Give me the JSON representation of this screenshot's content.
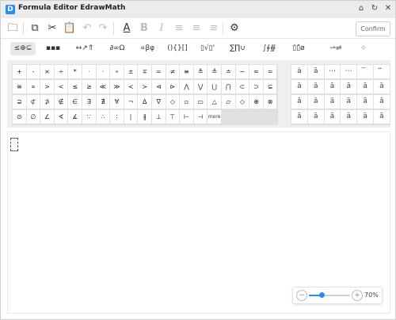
{
  "window": {
    "title": "Formula Editor EdrawMath",
    "logo_glyph": "D",
    "buttons": [
      {
        "name": "home-icon",
        "glyph": "⌂"
      },
      {
        "name": "refresh-icon",
        "glyph": "↻"
      },
      {
        "name": "close-icon",
        "glyph": "✕"
      }
    ]
  },
  "toolbar": {
    "tools": [
      {
        "name": "open-folder-button",
        "glyph": "🗀",
        "enabled": true
      },
      {
        "name": "copy-button",
        "glyph": "⧉",
        "enabled": true
      },
      {
        "name": "cut-button",
        "glyph": "✂",
        "enabled": true
      },
      {
        "name": "paste-button",
        "glyph": "📋",
        "enabled": true
      },
      {
        "name": "undo-button",
        "glyph": "↶",
        "enabled": false
      },
      {
        "name": "redo-button",
        "glyph": "↷",
        "enabled": false
      },
      {
        "name": "font-color-button",
        "glyph": "A",
        "enabled": true
      },
      {
        "name": "bold-button",
        "glyph": "B",
        "enabled": false
      },
      {
        "name": "italic-button",
        "glyph": "I",
        "enabled": false
      },
      {
        "name": "align-left-button",
        "glyph": "≡",
        "enabled": false
      },
      {
        "name": "align-center-button",
        "glyph": "≡",
        "enabled": false
      },
      {
        "name": "align-right-button",
        "glyph": "≡",
        "enabled": false
      },
      {
        "name": "settings-button",
        "glyph": "⚙",
        "enabled": true
      }
    ],
    "confirm_label": "Confirm"
  },
  "tabs": [
    {
      "name": "tab-relations",
      "label": "≤⊕⊆",
      "active": true
    },
    {
      "name": "tab-spaces",
      "label": "▪▪▪",
      "active": false
    },
    {
      "name": "tab-arrows",
      "label": "↔↗⇑",
      "active": false
    },
    {
      "name": "tab-misc",
      "label": "∂∞Ω",
      "active": false
    },
    {
      "name": "tab-greek",
      "label": "∝βφ",
      "active": false
    },
    {
      "name": "tab-brackets",
      "label": "(){}[]",
      "active": false
    },
    {
      "name": "tab-fractions",
      "label": "▯√▯'",
      "active": false
    },
    {
      "name": "tab-sums",
      "label": "∑∏∪",
      "active": false
    },
    {
      "name": "tab-integrals",
      "label": "∫∮∯",
      "active": false
    },
    {
      "name": "tab-accents",
      "label": "▯̇▯̂ø",
      "active": false
    },
    {
      "name": "tab-labeled-arrows",
      "label": "⇀⇌",
      "active": false
    },
    {
      "name": "tab-matrices",
      "label": "⁘",
      "active": false
    }
  ],
  "symbols": [
    [
      "+",
      "-",
      "×",
      "÷",
      "*",
      "·",
      "·",
      "∘",
      "±",
      "∓",
      "=",
      "≠",
      "≡",
      "≜",
      "≙",
      "≐",
      "∽",
      "≈",
      "≃"
    ],
    [
      "≅",
      "∝",
      ">",
      "<",
      "≤",
      "≥",
      "≪",
      "≫",
      "≺",
      "≻",
      "⊲",
      "⊳",
      "⋀",
      "⋁",
      "⋃",
      "⋂",
      "⊂",
      "⊃",
      "⊆"
    ],
    [
      "⊇",
      "⊄",
      "⊅",
      "∉",
      "∈",
      "∃",
      "∄",
      "∀",
      "¬",
      "∆",
      "∇",
      "◇",
      "▫",
      "▭",
      "△",
      "▱",
      "◇",
      "⊕",
      "⊗"
    ],
    [
      "⊙",
      "∅",
      "∠",
      "∢",
      "∡",
      "∵",
      "∴",
      "∶",
      "∣",
      "∦",
      "⊥",
      "⊤",
      "⊢",
      "⊣",
      "more"
    ]
  ],
  "accent_symbols": [
    [
      "ȧ",
      "ä",
      "⋯",
      "⋯",
      "⃛",
      "⃡"
    ],
    [
      "ā",
      "ā",
      "ā",
      "ā",
      "ā",
      "ā"
    ],
    [
      "ǎ",
      "â",
      "ȃ",
      "ă",
      "ã",
      "â"
    ],
    [
      "ā",
      "ā",
      "ā",
      "ā",
      "ā",
      "ā"
    ]
  ],
  "zoom": {
    "value": 0.3,
    "label": "70%"
  }
}
